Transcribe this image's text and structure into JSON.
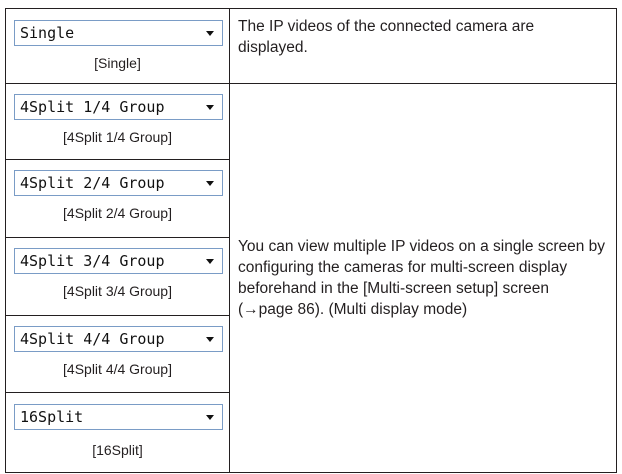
{
  "modes": [
    {
      "dropdown": "Single",
      "caption": "[Single]"
    },
    {
      "dropdown": "4Split 1/4 Group",
      "caption": "[4Split 1/4 Group]"
    },
    {
      "dropdown": "4Split 2/4 Group",
      "caption": "[4Split 2/4 Group]"
    },
    {
      "dropdown": "4Split 3/4 Group",
      "caption": "[4Split 3/4 Group]"
    },
    {
      "dropdown": "4Split 4/4 Group",
      "caption": "[4Split 4/4 Group]"
    },
    {
      "dropdown": "16Split",
      "caption": "[16Split]"
    }
  ],
  "descriptions": {
    "single": "The IP videos of the connected camera are displayed.",
    "multi": "You can view multiple IP videos on a single screen by configuring the cameras for multi-screen display beforehand in the [Multi-screen setup] screen (→page 86). (Multi display mode)"
  }
}
